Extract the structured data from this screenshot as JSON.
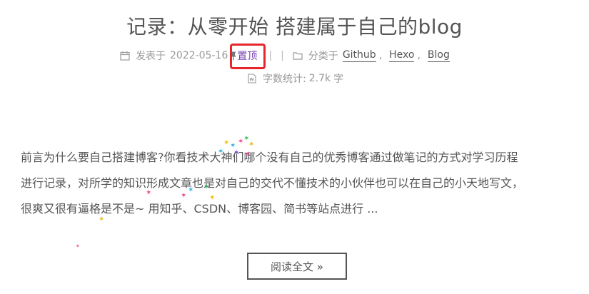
{
  "post": {
    "title": "记录：从零开始 搭建属于自己的blog",
    "meta": {
      "posted_label": "发表于",
      "posted_date": "2022-05-16",
      "pinned_label": "置顶",
      "separator": "|",
      "category_label": "分类于",
      "categories": [
        "Github",
        "Hexo",
        "Blog"
      ],
      "comma": ",",
      "wordcount_label": "字数统计:",
      "wordcount_value": "2.7k",
      "wordcount_unit": "字"
    },
    "excerpt": {
      "line1": "前言为什么要自己搭建博客?你看技术大神们哪个没有自己的优秀博客通过做笔记的方式对学习历程",
      "line2": "进行记录，对所学的知识形成文章也是对自己的交代不懂技术的小伙伴也可以在自己的小天地写文，",
      "line3": "很爽又很有逼格是不是~ 用知乎、CSDN、博客园、简书等站点进行 ..."
    },
    "read_more_label": "阅读全文 »"
  },
  "colors": {
    "highlight": "#e8252a",
    "pinned_link": "#7b3fb0",
    "text": "#555555",
    "meta_text": "#999999"
  },
  "icons": {
    "calendar": "calendar-icon",
    "pin": "pushpin-icon",
    "folder": "folder-icon",
    "word_file": "word-file-icon"
  }
}
